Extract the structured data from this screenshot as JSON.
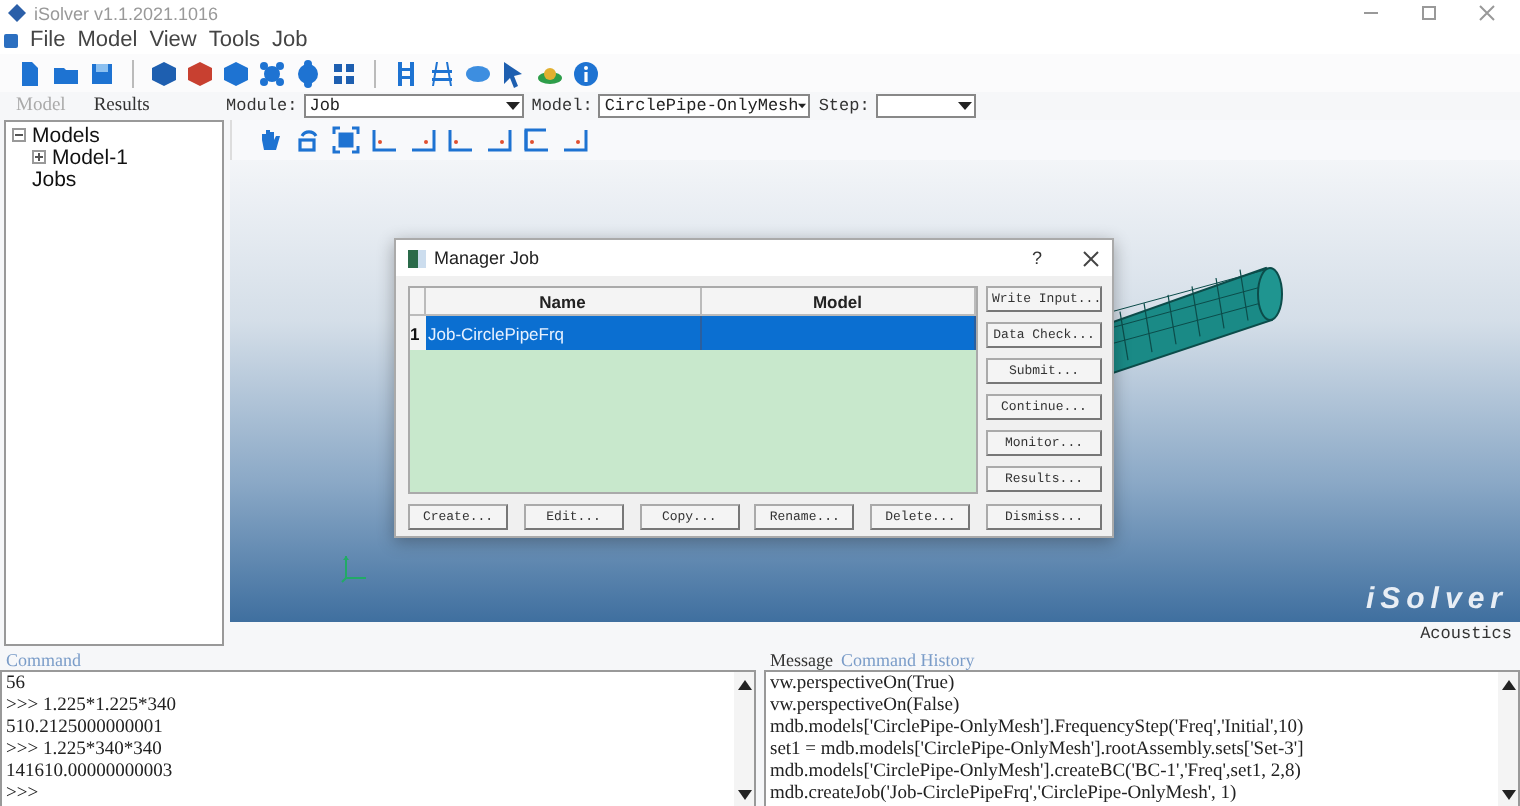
{
  "window": {
    "title": "iSolver v1.1.2021.1016"
  },
  "menu": [
    "File",
    "Model",
    "View",
    "Tools",
    "Job"
  ],
  "panel_tabs": [
    {
      "label": "Model",
      "selected": true
    },
    {
      "label": "Results",
      "selected": false
    }
  ],
  "selectors": [
    {
      "label": "Module:",
      "value": "Job"
    },
    {
      "label": "Model:",
      "value": "CirclePipe-OnlyMesh"
    },
    {
      "label": "Step:"
    }
  ],
  "tree": [
    {
      "label": "Models",
      "expanded": true,
      "children": [
        {
          "label": "Model-1",
          "expanded": false
        }
      ]
    },
    {
      "label": "Jobs"
    }
  ],
  "viewport": {
    "logo_text": "iSolver"
  },
  "status_bar": {
    "module_name": "Acoustics"
  },
  "dialog": {
    "title": "Manager Job",
    "help": "?",
    "table": {
      "columns": [
        "Name",
        "Model"
      ],
      "rows": [
        {
          "number": "1",
          "name": "Job-CirclePipeFrq",
          "selected": true
        }
      ]
    },
    "side_buttons": [
      "Write Input...",
      "Data Check...",
      "Submit...",
      "Continue...",
      "Monitor...",
      "Results..."
    ],
    "bottom_buttons": [
      "Create...",
      "Edit...",
      "Copy...",
      "Rename...",
      "Delete...",
      "Dismiss..."
    ]
  },
  "command_panel": {
    "title": "Command",
    "lines": [
      "56",
      ">>> 1.225*1.225*340",
      "510.2125000000001",
      ">>> 1.225*340*340",
      "141610.00000000003",
      ">>>"
    ]
  },
  "message_panel": {
    "tabs": [
      {
        "label": "Message",
        "selected": true
      },
      {
        "label": "Command History",
        "selected": false
      }
    ],
    "lines": [
      "vw.perspectiveOn(True)",
      "vw.perspectiveOn(False)",
      "mdb.models['CirclePipe-OnlyMesh'].FrequencyStep('Freq','Initial',10)",
      "set1 = mdb.models['CirclePipe-OnlyMesh'].rootAssembly.sets['Set-3']",
      "mdb.models['CirclePipe-OnlyMesh'].createBC('BC-1','Freq',set1, 2,8)",
      "mdb.createJob('Job-CirclePipeFrq','CirclePipe-OnlyMesh', 1)"
    ]
  }
}
